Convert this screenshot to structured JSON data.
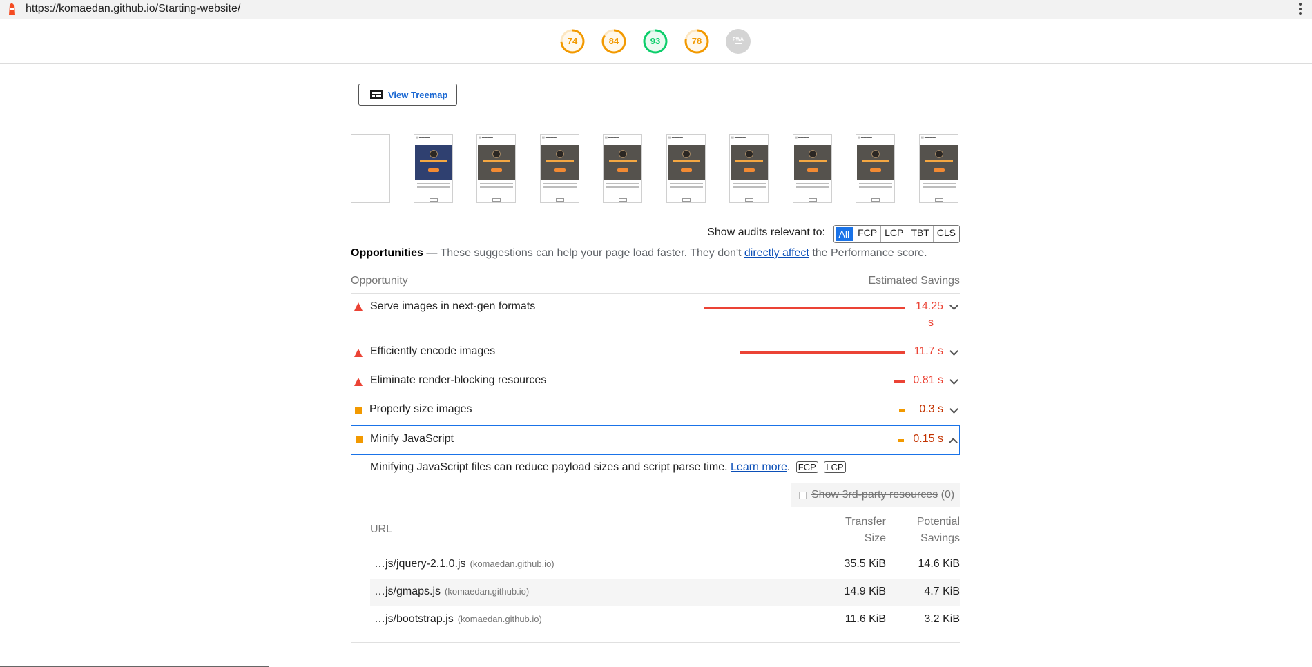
{
  "browser": {
    "url": "https://komaedan.github.io/Starting-website/"
  },
  "scores": [
    {
      "value": "74",
      "fraction": 0.74,
      "color": "#f29900"
    },
    {
      "value": "84",
      "fraction": 0.84,
      "color": "#f29900"
    },
    {
      "value": "93",
      "fraction": 0.93,
      "color": "#0cce6b"
    },
    {
      "value": "78",
      "fraction": 0.78,
      "color": "#f29900"
    },
    {
      "value": "PWA",
      "fraction": 0,
      "color": "#c6c6c6"
    }
  ],
  "treemap": {
    "label": "View Treemap"
  },
  "filter": {
    "label": "Show audits relevant to:",
    "chips": [
      "All",
      "FCP",
      "LCP",
      "TBT",
      "CLS"
    ]
  },
  "opportunities": {
    "heading": "Opportunities",
    "desc_pre": "— These suggestions can help your page load faster. They don't",
    "link": "directly affect",
    "desc_post": "the Performance score.",
    "col_left": "Opportunity",
    "col_right": "Estimated Savings",
    "items": [
      {
        "title": "Serve images in next-gen formats",
        "value_line1": "14.25",
        "value_line2": "s",
        "severity": "fail",
        "savings_s": 14.25
      },
      {
        "title": "Efficiently encode images",
        "value": "11.7 s",
        "severity": "fail",
        "savings_s": 11.7
      },
      {
        "title": "Eliminate render-blocking resources",
        "value": "0.81 s",
        "severity": "fail",
        "savings_s": 0.81
      },
      {
        "title": "Properly size images",
        "value": "0.3 s",
        "severity": "average",
        "savings_s": 0.3
      },
      {
        "title": "Minify JavaScript",
        "value": "0.15 s",
        "severity": "average",
        "savings_s": 0.15
      }
    ]
  },
  "details": {
    "desc": "Minifying JavaScript files can reduce payload sizes and script parse time.",
    "learn_more": "Learn more",
    "tags": [
      "FCP",
      "LCP"
    ],
    "third_party_label": "Show 3rd-party resources",
    "third_party_count": "(0)",
    "col_url": "URL",
    "col_transfer_1": "Transfer",
    "col_transfer_2": "Size",
    "col_savings_1": "Potential",
    "col_savings_2": "Savings",
    "rows": [
      {
        "url": "…js/jquery-2.1.0.js",
        "host": "(komaedan.github.io)",
        "size": "35.5 KiB",
        "savings": "14.6 KiB"
      },
      {
        "url": "…js/gmaps.js",
        "host": "(komaedan.github.io)",
        "size": "14.9 KiB",
        "savings": "4.7 KiB"
      },
      {
        "url": "…js/bootstrap.js",
        "host": "(komaedan.github.io)",
        "size": "11.6 KiB",
        "savings": "3.2 KiB"
      }
    ]
  },
  "colors": {
    "fail": "#eb4335",
    "average": "#f29900",
    "accent": "#1a73e8"
  }
}
